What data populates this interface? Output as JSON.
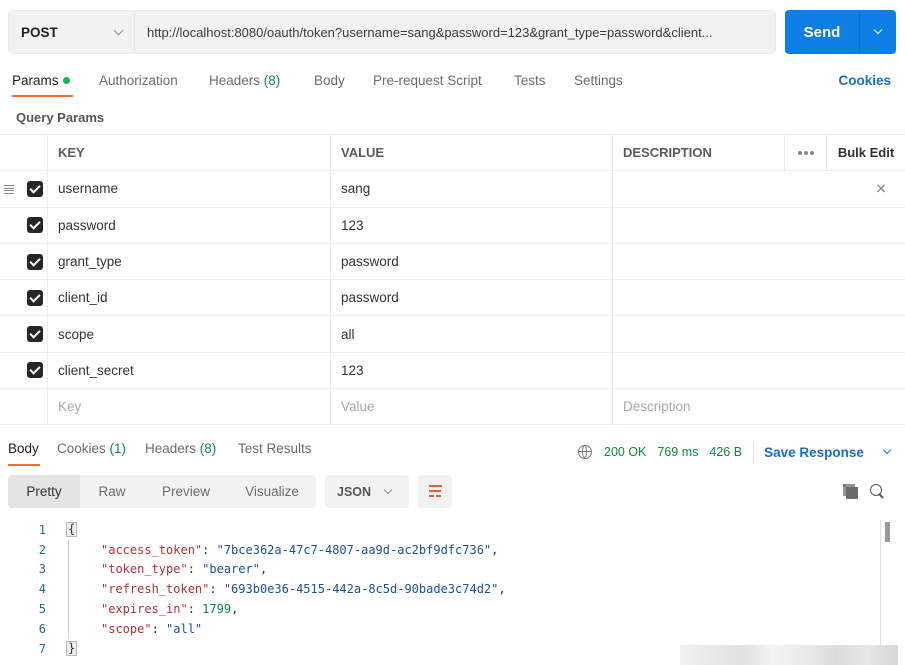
{
  "request": {
    "method": "POST",
    "url": "http://localhost:8080/oauth/token?username=sang&password=123&grant_type=password&client...",
    "send_label": "Send"
  },
  "request_tabs": {
    "params": "Params",
    "authorization": "Authorization",
    "headers": "Headers",
    "headers_count": "(8)",
    "body": "Body",
    "prerequest": "Pre-request Script",
    "tests": "Tests",
    "settings": "Settings",
    "cookies_link": "Cookies"
  },
  "query_params": {
    "title": "Query Params",
    "columns": {
      "key": "KEY",
      "value": "VALUE",
      "description": "DESCRIPTION",
      "bulk_edit": "Bulk Edit"
    },
    "rows": [
      {
        "key": "username",
        "value": "sang",
        "checked": true
      },
      {
        "key": "password",
        "value": "123",
        "checked": true
      },
      {
        "key": "grant_type",
        "value": "password",
        "checked": true
      },
      {
        "key": "client_id",
        "value": "password",
        "checked": true
      },
      {
        "key": "scope",
        "value": "all",
        "checked": true
      },
      {
        "key": "client_secret",
        "value": "123",
        "checked": true
      }
    ],
    "new_row_placeholders": {
      "key": "Key",
      "value": "Value",
      "description": "Description"
    }
  },
  "response_tabs": {
    "body": "Body",
    "cookies": "Cookies",
    "cookies_count": "(1)",
    "headers": "Headers",
    "headers_count": "(8)",
    "test_results": "Test Results"
  },
  "response_status": {
    "status": "200 OK",
    "time": "769 ms",
    "size": "426 B",
    "save_label": "Save Response"
  },
  "view_modes": [
    "Pretty",
    "Raw",
    "Preview",
    "Visualize"
  ],
  "format": "JSON",
  "response_body": {
    "line_numbers": [
      "1",
      "2",
      "3",
      "4",
      "5",
      "6",
      "7"
    ],
    "open_brace": "{",
    "close_brace": "}",
    "fields": [
      {
        "key": "\"access_token\"",
        "value": "\"7bce362a-47c7-4807-aa9d-ac2bf9dfc736\"",
        "type": "string",
        "comma": ","
      },
      {
        "key": "\"token_type\"",
        "value": "\"bearer\"",
        "type": "string",
        "comma": ","
      },
      {
        "key": "\"refresh_token\"",
        "value": "\"693b0e36-4515-442a-8c5d-90bade3c74d2\"",
        "type": "string",
        "comma": ","
      },
      {
        "key": "\"expires_in\"",
        "value": "1799",
        "type": "number",
        "comma": ","
      },
      {
        "key": "\"scope\"",
        "value": "\"all\"",
        "type": "string",
        "comma": ""
      }
    ]
  },
  "colors": {
    "accent_send": "#0c7ee6",
    "tab_underline": "#f26b3a",
    "status_ok": "#0b8a3e",
    "link": "#1a6ccf"
  }
}
